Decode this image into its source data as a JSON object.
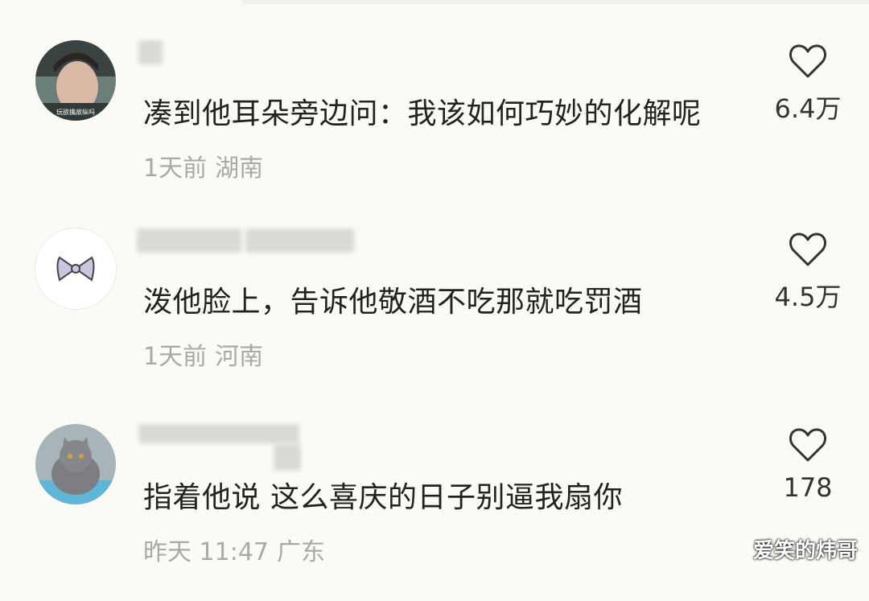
{
  "comments": [
    {
      "text": "凑到他耳朵旁边问：我该如何巧妙的化解呢",
      "time": "1天前",
      "location": "湖南",
      "likes": "6.4万",
      "avatar_caption": "玩欲擒故纵吗"
    },
    {
      "text": "泼他脸上，告诉他敬酒不吃那就吃罚酒",
      "time": "1天前",
      "location": "河南",
      "likes": "4.5万"
    },
    {
      "text": "指着他说 这么喜庆的日子别逼我扇你",
      "time": "昨天 11:47",
      "location": "广东",
      "likes": "178"
    }
  ],
  "watermark": "爱笑的炜哥",
  "icons": {
    "like": "heart-icon"
  },
  "colors": {
    "background": "#fbfaf5",
    "text": "#222222",
    "meta": "#a9a9a9"
  }
}
